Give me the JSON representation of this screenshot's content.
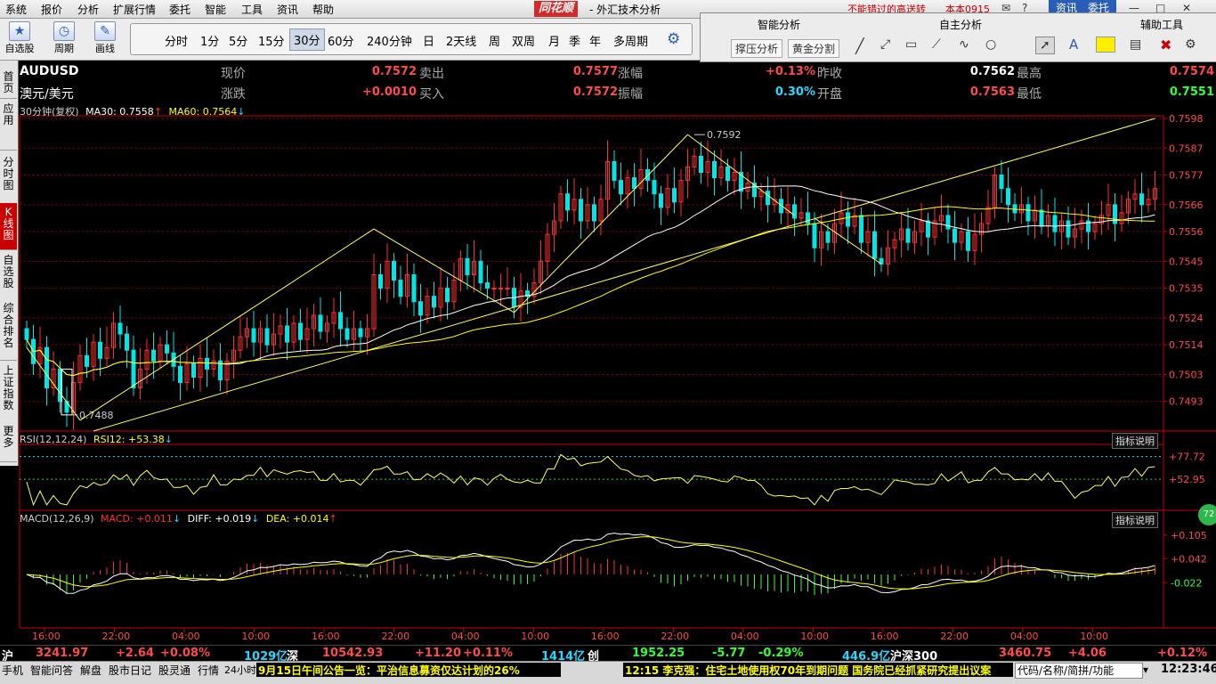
{
  "menu": [
    "系统",
    "报价",
    "分析",
    "扩展行情",
    "委托",
    "智能",
    "工具",
    "资讯",
    "帮助"
  ],
  "brand": "同花顺",
  "app_title": "- 外汇技术分析",
  "marquee": "不能错过的高送转",
  "user": "本本0915",
  "top_buttons": {
    "news": "资讯",
    "trade": "委托"
  },
  "toolbar": {
    "watchlist": "自选股",
    "cycle": "周期",
    "draw": "画线"
  },
  "periods": [
    "分时",
    "1分",
    "5分",
    "15分",
    "30分",
    "60分",
    "240分钟",
    "日",
    "2天线",
    "周",
    "双周",
    "月",
    "季",
    "年",
    "多周期"
  ],
  "selected_period": "30分",
  "right_panel": {
    "smart": "智能分析",
    "self": "自主分析",
    "aux": "辅助工具",
    "btn1": "撑压分析",
    "btn2": "黄金分割"
  },
  "sidebar": [
    "首页",
    "应用",
    "分时图",
    "K线图",
    "自选股",
    "综合排名",
    "上证指数",
    "更多"
  ],
  "quote": {
    "symbol": "AUDUSD",
    "name": "澳元/美元",
    "fields": [
      {
        "label": "现价",
        "value": "0.7572",
        "color": "#ff4b4b"
      },
      {
        "label": "卖出",
        "value": "0.7577",
        "color": "#ff4b4b"
      },
      {
        "label": "涨幅",
        "value": "+0.13%",
        "color": "#ff4b4b"
      },
      {
        "label": "昨收",
        "value": "0.7562",
        "color": "#ffffff"
      },
      {
        "label": "最高",
        "value": "0.7574",
        "color": "#ff4b4b"
      },
      {
        "label": "涨跌",
        "value": "+0.0010",
        "color": "#ff4b4b"
      },
      {
        "label": "买入",
        "value": "0.7572",
        "color": "#ff4b4b"
      },
      {
        "label": "振幅",
        "value": "0.30%",
        "color": "#29d7ff"
      },
      {
        "label": "开盘",
        "value": "0.7563",
        "color": "#ff4b4b"
      },
      {
        "label": "最低",
        "value": "0.7551",
        "color": "#33ff33"
      }
    ]
  },
  "main_legend": {
    "period": "30分钟(复权)",
    "ma30": "MA30: 0.7558",
    "ma60": "MA60: 0.7564"
  },
  "rsi_legend": {
    "title": "RSI(12,12,24)",
    "val": "RSI12: +53.38"
  },
  "macd_legend": {
    "title": "MACD(12,26,9)",
    "macd": "MACD: +0.011",
    "diff": "DIFF: +0.019",
    "dea": "DEA: +0.014"
  },
  "indicator_btn": "指标说明",
  "badge": "72",
  "chart_data": {
    "type": "candlestick",
    "symbol": "AUDUSD",
    "price_ylim": [
      0.7482,
      0.7598
    ],
    "price_ticks": [
      0.7598,
      0.7587,
      0.7577,
      0.7566,
      0.7556,
      0.7545,
      0.7535,
      0.7524,
      0.7514,
      0.7503,
      0.7493
    ],
    "annotations": [
      {
        "label": "0.7592",
        "value": 0.7592
      },
      {
        "label": "0.7488",
        "value": 0.7488
      }
    ],
    "time_labels": [
      "16:00",
      "22:00",
      "04:00",
      "10:00",
      "16:00",
      "22:00",
      "04:00",
      "10:00",
      "16:00",
      "22:00",
      "04:00",
      "10:00",
      "16:00",
      "22:00",
      "04:00",
      "10:00"
    ],
    "candles": [
      [
        0.752,
        0.7516
      ],
      [
        0.7516,
        0.7507
      ],
      [
        0.7507,
        0.7513
      ],
      [
        0.7513,
        0.7498
      ],
      [
        0.7498,
        0.7505
      ],
      [
        0.7505,
        0.7493
      ],
      [
        0.7493,
        0.7489
      ],
      [
        0.7489,
        0.75
      ],
      [
        0.75,
        0.751
      ],
      [
        0.751,
        0.7506
      ],
      [
        0.7506,
        0.7515
      ],
      [
        0.7515,
        0.7509
      ],
      [
        0.7509,
        0.7513
      ],
      [
        0.7513,
        0.7522
      ],
      [
        0.7522,
        0.7518
      ],
      [
        0.7518,
        0.7512
      ],
      [
        0.7512,
        0.7498
      ],
      [
        0.7498,
        0.7505
      ],
      [
        0.7505,
        0.7512
      ],
      [
        0.7512,
        0.7508
      ],
      [
        0.7508,
        0.7514
      ],
      [
        0.7514,
        0.7511
      ],
      [
        0.7511,
        0.7506
      ],
      [
        0.7506,
        0.75
      ],
      [
        0.75,
        0.7507
      ],
      [
        0.7507,
        0.7502
      ],
      [
        0.7502,
        0.7509
      ],
      [
        0.7509,
        0.7505
      ],
      [
        0.7505,
        0.7508
      ],
      [
        0.7508,
        0.7501
      ],
      [
        0.7501,
        0.7508
      ],
      [
        0.7508,
        0.7512
      ],
      [
        0.7512,
        0.7517
      ],
      [
        0.7517,
        0.752
      ],
      [
        0.752,
        0.7515
      ],
      [
        0.7515,
        0.752
      ],
      [
        0.752,
        0.7514
      ],
      [
        0.7514,
        0.7518
      ],
      [
        0.7518,
        0.7521
      ],
      [
        0.7521,
        0.7515
      ],
      [
        0.7515,
        0.7522
      ],
      [
        0.7522,
        0.7516
      ],
      [
        0.7516,
        0.752
      ],
      [
        0.752,
        0.7525
      ],
      [
        0.7525,
        0.7519
      ],
      [
        0.7519,
        0.7522
      ],
      [
        0.7522,
        0.7526
      ],
      [
        0.7526,
        0.752
      ],
      [
        0.752,
        0.7516
      ],
      [
        0.7516,
        0.752
      ],
      [
        0.752,
        0.7517
      ],
      [
        0.7517,
        0.752
      ],
      [
        0.752,
        0.754
      ],
      [
        0.754,
        0.7535
      ],
      [
        0.7535,
        0.7545
      ],
      [
        0.7545,
        0.7538
      ],
      [
        0.7538,
        0.7532
      ],
      [
        0.7532,
        0.754
      ],
      [
        0.754,
        0.753
      ],
      [
        0.753,
        0.7525
      ],
      [
        0.7525,
        0.7532
      ],
      [
        0.7532,
        0.7528
      ],
      [
        0.7528,
        0.7535
      ],
      [
        0.7535,
        0.753
      ],
      [
        0.753,
        0.7538
      ],
      [
        0.7538,
        0.7546
      ],
      [
        0.7546,
        0.754
      ],
      [
        0.754,
        0.7545
      ],
      [
        0.7545,
        0.7537
      ],
      [
        0.7537,
        0.7535
      ],
      [
        0.7535,
        0.7535
      ],
      [
        0.7535,
        0.7535
      ],
      [
        0.7535,
        0.7535
      ],
      [
        0.7535,
        0.7528
      ],
      [
        0.7528,
        0.7534
      ],
      [
        0.7534,
        0.7532
      ],
      [
        0.7532,
        0.7537
      ],
      [
        0.7537,
        0.7545
      ],
      [
        0.7545,
        0.7555
      ],
      [
        0.7555,
        0.756
      ],
      [
        0.756,
        0.757
      ],
      [
        0.757,
        0.7564
      ],
      [
        0.7564,
        0.7568
      ],
      [
        0.7568,
        0.756
      ],
      [
        0.756,
        0.7566
      ],
      [
        0.7566,
        0.756
      ],
      [
        0.756,
        0.7568
      ],
      [
        0.7568,
        0.7582
      ],
      [
        0.7582,
        0.7575
      ],
      [
        0.7575,
        0.757
      ],
      [
        0.757,
        0.7576
      ],
      [
        0.7576,
        0.7572
      ],
      [
        0.7572,
        0.7579
      ],
      [
        0.7579,
        0.7575
      ],
      [
        0.7575,
        0.757
      ],
      [
        0.757,
        0.7565
      ],
      [
        0.7565,
        0.7572
      ],
      [
        0.7572,
        0.7567
      ],
      [
        0.7567,
        0.7575
      ],
      [
        0.7575,
        0.758
      ],
      [
        0.758,
        0.7584
      ],
      [
        0.7584,
        0.7578
      ],
      [
        0.7578,
        0.7582
      ],
      [
        0.7582,
        0.7576
      ],
      [
        0.7576,
        0.758
      ],
      [
        0.758,
        0.7575
      ],
      [
        0.7575,
        0.7578
      ],
      [
        0.7578,
        0.7571
      ],
      [
        0.7571,
        0.7574
      ],
      [
        0.7574,
        0.7569
      ],
      [
        0.7569,
        0.7571
      ],
      [
        0.7571,
        0.7566
      ],
      [
        0.7566,
        0.7568
      ],
      [
        0.7568,
        0.7563
      ],
      [
        0.7563,
        0.7566
      ],
      [
        0.7566,
        0.7561
      ],
      [
        0.7561,
        0.7563
      ],
      [
        0.7563,
        0.7559
      ],
      [
        0.7559,
        0.755
      ],
      [
        0.755,
        0.7556
      ],
      [
        0.7556,
        0.7552
      ],
      [
        0.7552,
        0.7559
      ],
      [
        0.7559,
        0.7563
      ],
      [
        0.7563,
        0.7558
      ],
      [
        0.7558,
        0.7562
      ],
      [
        0.7562,
        0.7552
      ],
      [
        0.7552,
        0.7556
      ],
      [
        0.7556,
        0.7546
      ],
      [
        0.7546,
        0.7544
      ],
      [
        0.7544,
        0.755
      ],
      [
        0.755,
        0.7553
      ],
      [
        0.7553,
        0.7557
      ],
      [
        0.7557,
        0.7552
      ],
      [
        0.7552,
        0.7556
      ],
      [
        0.7556,
        0.756
      ],
      [
        0.756,
        0.7554
      ],
      [
        0.7554,
        0.756
      ],
      [
        0.756,
        0.7562
      ],
      [
        0.7562,
        0.7557
      ],
      [
        0.7557,
        0.7552
      ],
      [
        0.7552,
        0.7556
      ],
      [
        0.7556,
        0.7549
      ],
      [
        0.7549,
        0.7555
      ],
      [
        0.7555,
        0.7559
      ],
      [
        0.7559,
        0.7565
      ],
      [
        0.7565,
        0.7577
      ],
      [
        0.7577,
        0.7572
      ],
      [
        0.7572,
        0.7566
      ],
      [
        0.7566,
        0.7563
      ],
      [
        0.7563,
        0.7566
      ],
      [
        0.7566,
        0.756
      ],
      [
        0.756,
        0.7564
      ],
      [
        0.7564,
        0.7558
      ],
      [
        0.7558,
        0.7562
      ],
      [
        0.7562,
        0.7556
      ],
      [
        0.7556,
        0.756
      ],
      [
        0.756,
        0.7554
      ],
      [
        0.7554,
        0.7557
      ],
      [
        0.7557,
        0.756
      ],
      [
        0.756,
        0.7556
      ],
      [
        0.7556,
        0.7559
      ],
      [
        0.7559,
        0.7562
      ],
      [
        0.7562,
        0.7566
      ],
      [
        0.7566,
        0.7559
      ],
      [
        0.7559,
        0.7563
      ],
      [
        0.7563,
        0.7568
      ],
      [
        0.7568,
        0.757
      ],
      [
        0.757,
        0.7566
      ],
      [
        0.7566,
        0.7568
      ],
      [
        0.7568,
        0.7572
      ]
    ],
    "rsi_ticks": [
      77.72,
      52.95
    ],
    "macd_ticks": [
      0.105,
      0.042,
      -0.022
    ]
  },
  "index_bar": {
    "sh_label": "沪",
    "sh": "3241.97",
    "sh_chg": "+2.64",
    "sh_pct": "+0.08%",
    "sh_amt": "1029亿",
    "sz_label": "深",
    "sz": "10542.93",
    "sz_chg": "+11.20",
    "sz_pct": "+0.11%",
    "sz_amt": "1414亿",
    "cy_label": "创",
    "cy": "1952.25",
    "cy_chg": "-5.77",
    "cy_pct": "-0.29%",
    "cy_amt": "446.9亿",
    "hs_label": "沪深300",
    "hs": "3460.75",
    "hs_chg": "+4.06",
    "hs_pct": "+0.12%"
  },
  "taskbar": {
    "items": [
      "手机",
      "智能问答",
      "解盘",
      "股市日记",
      "股灵通",
      "行情",
      "24小时滚动"
    ],
    "news1": "9月15日午间公告一览：平治信息募资仅达计划的26%",
    "news2": "12:15 李克强：住宅土地使用权70年到期问题 国务院已经抓紧研究提出议案",
    "code_placeholder": "代码/名称/简拼/功能",
    "clock": "12:23:46"
  },
  "colors": {
    "up": "#ff3030",
    "down": "#00e6e6",
    "ma": "#ffff00",
    "white": "#ffffff",
    "grid": "#8b0000"
  }
}
